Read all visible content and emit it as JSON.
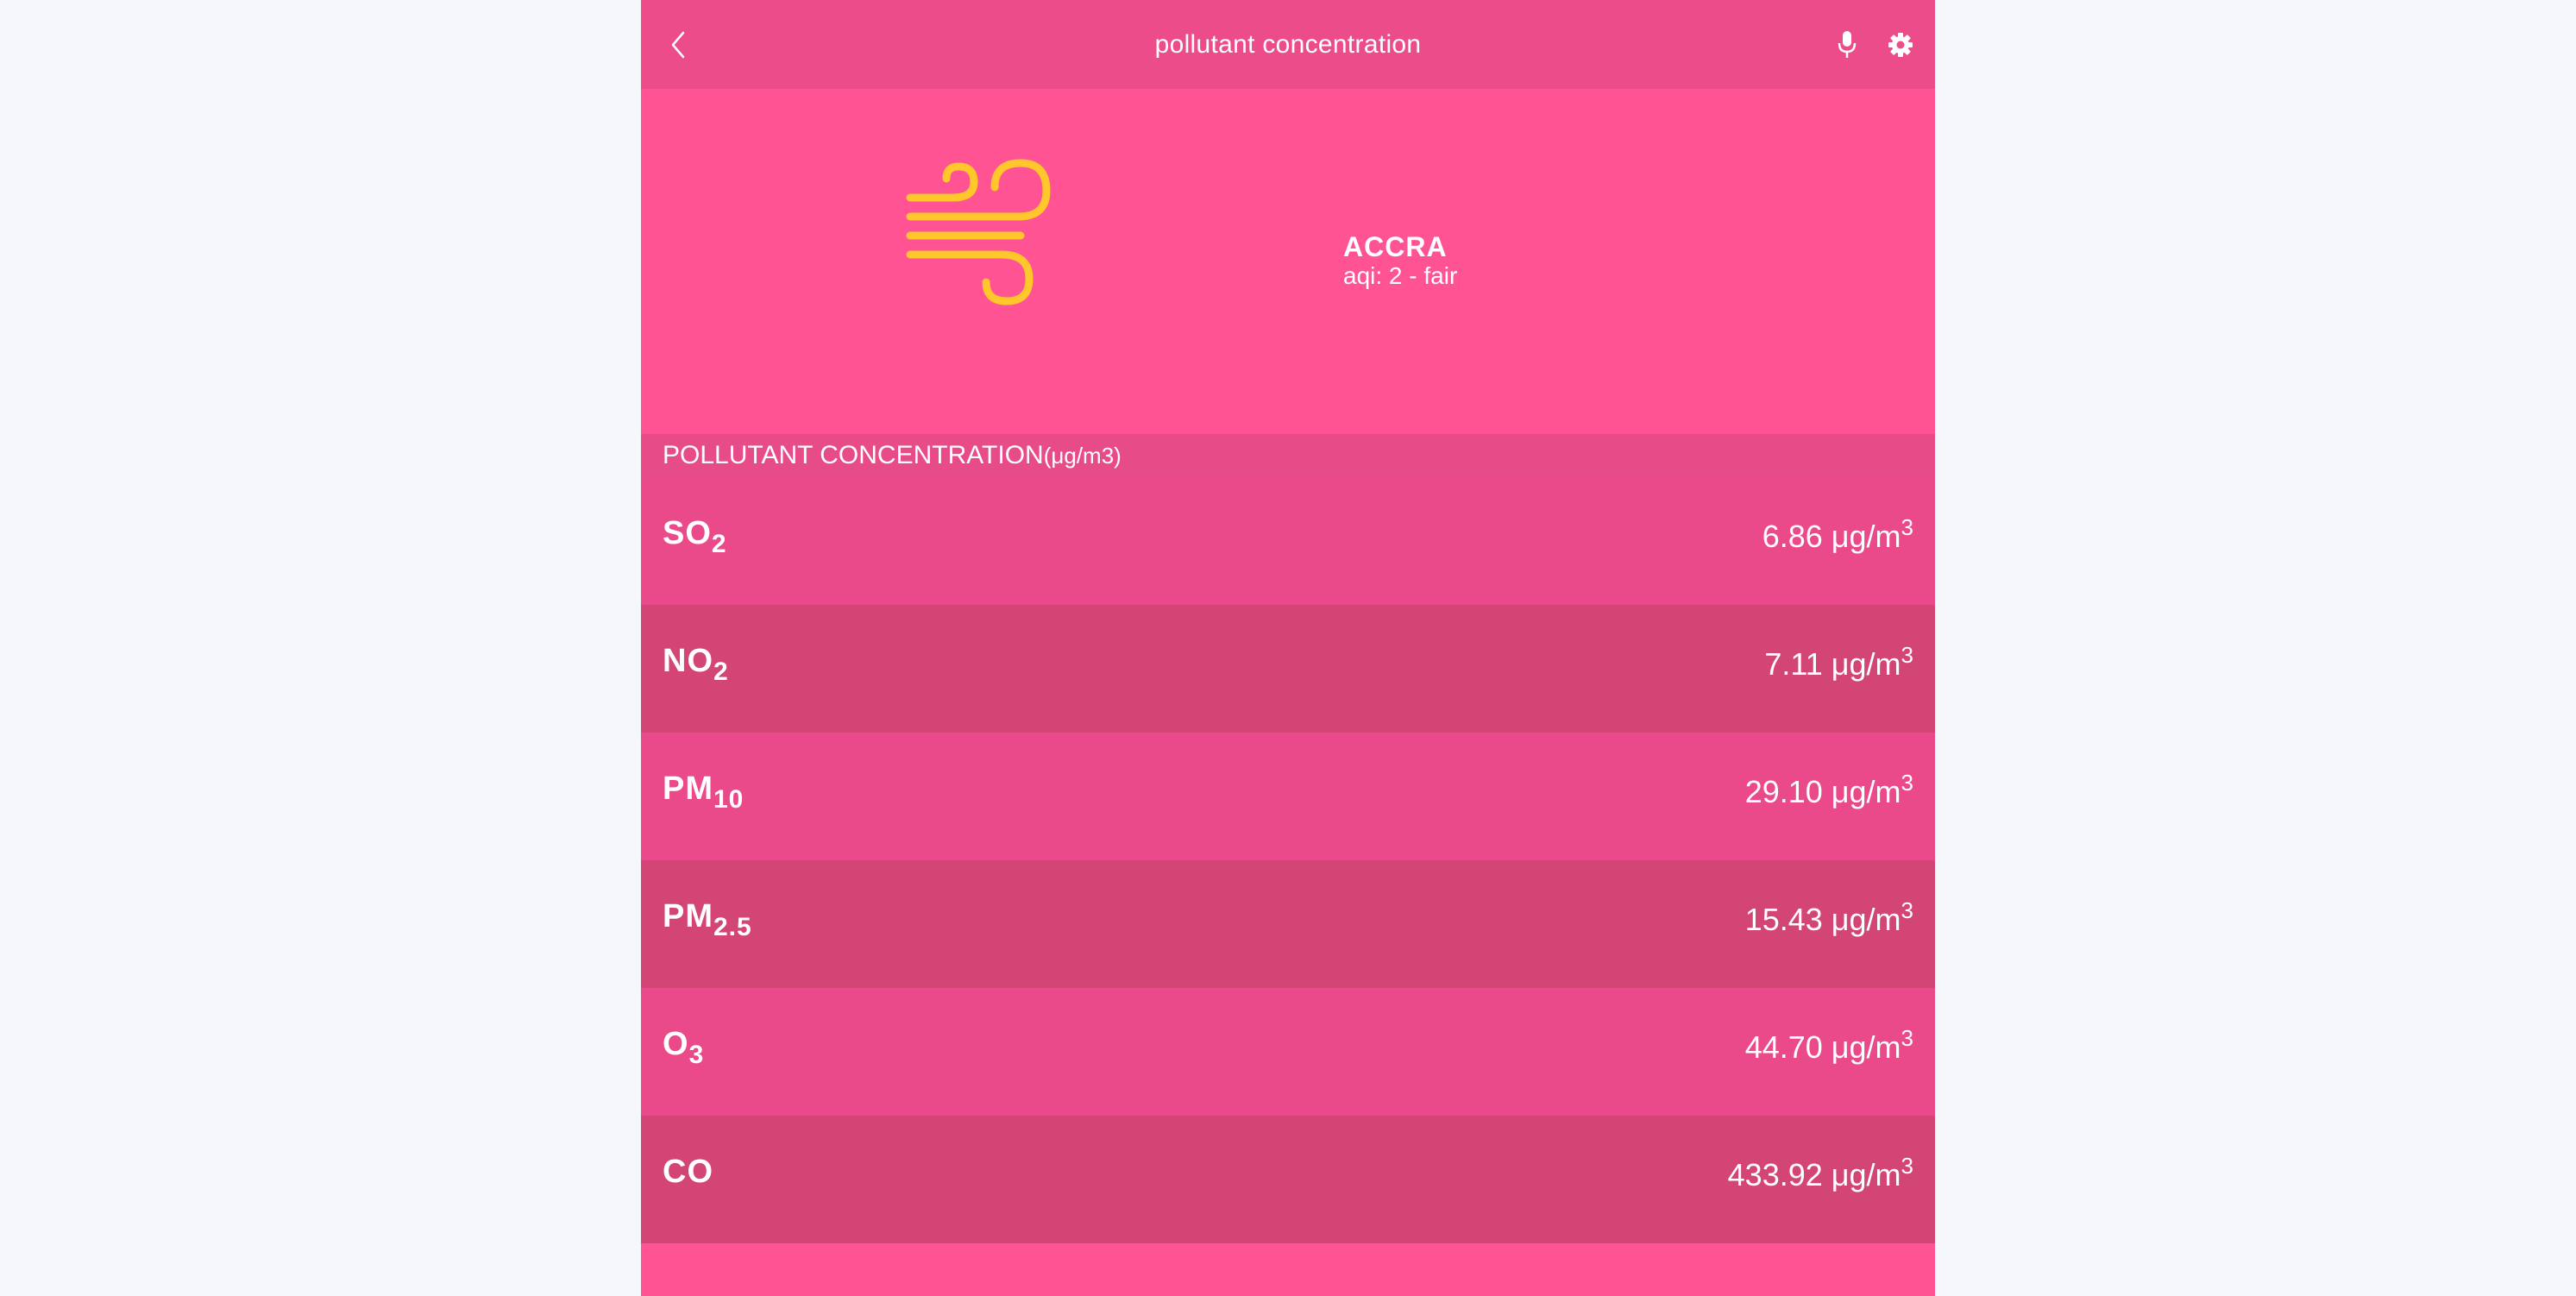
{
  "header": {
    "title": "pollutant concentration",
    "icons": [
      "chevron-left-icon",
      "microphone-icon",
      "gear-icon"
    ]
  },
  "location": {
    "city": "ACCRA",
    "aqi": "aqi: 2 - fair",
    "icon": "wind-icon",
    "icon_color": "#ffc72c"
  },
  "section": {
    "title": "POLLUTANT CONCENTRATION",
    "unit": "(μg/m3)"
  },
  "pollutants": [
    {
      "base": "SO",
      "sub": "2",
      "value": "6.86 μg/m",
      "exp": "3"
    },
    {
      "base": "NO",
      "sub": "2",
      "value": "7.11 μg/m",
      "exp": "3"
    },
    {
      "base": "PM",
      "sub": "10",
      "value": "29.10 μg/m",
      "exp": "3"
    },
    {
      "base": "PM",
      "sub": "2.5",
      "value": "15.43 μg/m",
      "exp": "3"
    },
    {
      "base": "O",
      "sub": "3",
      "value": "44.70 μg/m",
      "exp": "3"
    },
    {
      "base": "CO",
      "sub": "",
      "value": "433.92 μg/m",
      "exp": "3"
    }
  ],
  "colors": {
    "page_bg": "#f6f7fa",
    "app_bg": "#ff5394",
    "topbar": "#ec4c8a",
    "row_light": "#ea4a8a",
    "row_dark": "#d24575",
    "text": "#ffffff"
  }
}
